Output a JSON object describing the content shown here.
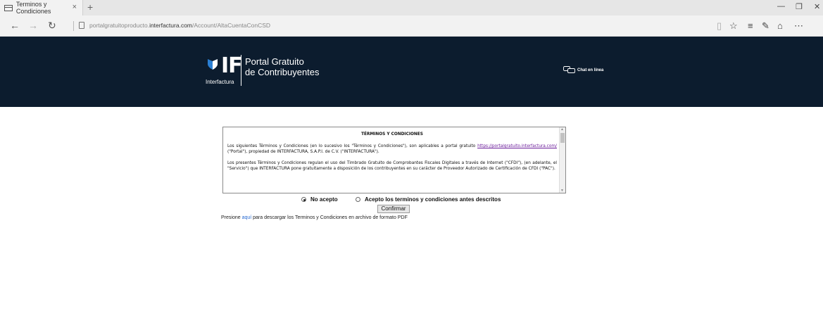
{
  "browser": {
    "tab_title": "Terminos y Condiciones",
    "tab_close": "×",
    "new_tab": "+",
    "url_prefix": "portalgratuitoproducto.",
    "url_domain": "interfactura.com",
    "url_path": "/Account/AltaCuentaConCSD"
  },
  "header": {
    "logo_text": "IF",
    "logo_sub": "Interfactura",
    "title_line1": "Portal Gratuito",
    "title_line2": "de Contribuyentes",
    "chat_label": "Chat en línea"
  },
  "terms": {
    "title": "TÉRMINOS Y CONDICIONES",
    "p1_before": "Los siguientes Términos y Condiciones (en lo sucesivo los \"Términos y Condiciones\"), son aplicables a portal gratuito ",
    "p1_link": "https://portalgratuito.interfactura.com/",
    "p1_after": " (\"Portal\"), propiedad de INTERFACTURA, S.A.P.I. de C.V. (\"INTERFACTURA\").",
    "p2": "Los presentes Términos y Condiciones regulan el uso del Timbrado Gratuito de Comprobantes Fiscales Digitales a través de Internet (\"CFDI\"), (en adelante, el \"Servicio\") que INTERFACTURA pone gratuitamente a disposición de los contribuyentes en su carácter de Proveedor Autorizado de Certificación de CFDI (\"PAC\")."
  },
  "form": {
    "option_reject": "No acepto",
    "option_accept": "Acepto los terminos y condiciones antes descritos",
    "selected": "No acepto",
    "confirm_label": "Confirmar"
  },
  "download": {
    "before": "Presione ",
    "link": "aquí",
    "after": " para descargar los Terminos y Condiciones en archivo de formato PDF"
  }
}
